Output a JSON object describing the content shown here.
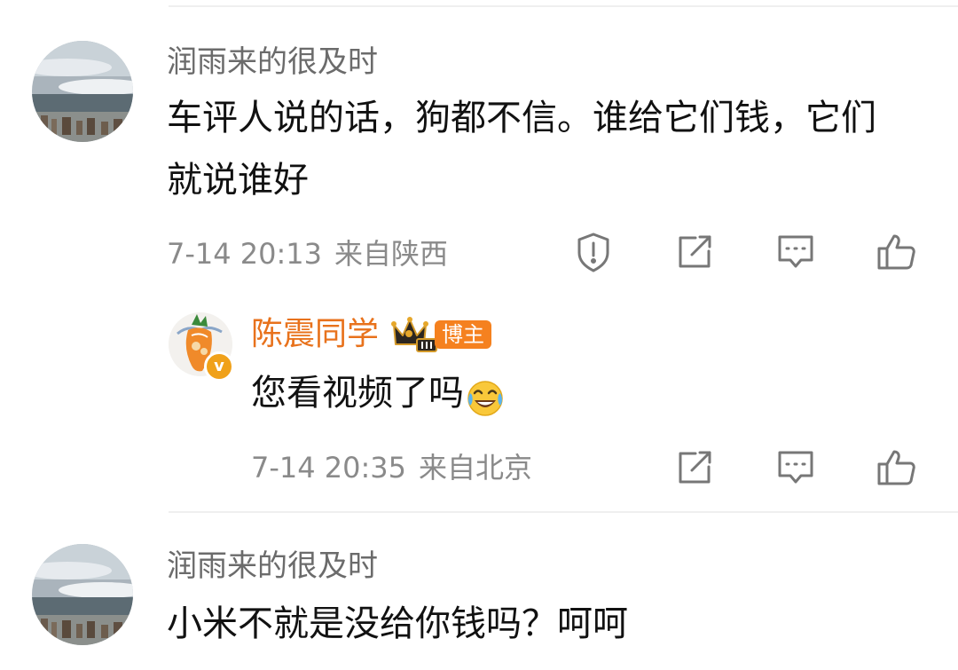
{
  "comments": [
    {
      "username": "润雨来的很及时",
      "text": "车评人说的话，狗都不信。谁给它们钱，它们就说谁好",
      "time": "7-14 20:13",
      "location": "来自陕西",
      "reply": {
        "username": "陈震同学",
        "badge": "博主",
        "text": "您看视频了吗",
        "emoji_icon": "laugh-cry-emoji-icon",
        "time": "7-14 20:35",
        "location": "来自北京"
      }
    },
    {
      "username": "润雨来的很及时",
      "text": "小米不就是没给你钱吗？呵呵"
    }
  ],
  "icons": {
    "report": "exclamation-shield-icon",
    "repost": "share-edit-icon",
    "comment": "comment-bubble-icon",
    "like": "thumbs-up-icon",
    "crown": "crown-icon",
    "verified": "verified-v-icon"
  },
  "colors": {
    "blogger_name": "#e8721c",
    "badge_bg": "#f5811f",
    "verified": "#f0a11a",
    "meta_text": "#8a8a8a",
    "username_gray": "#6b6b6b"
  }
}
